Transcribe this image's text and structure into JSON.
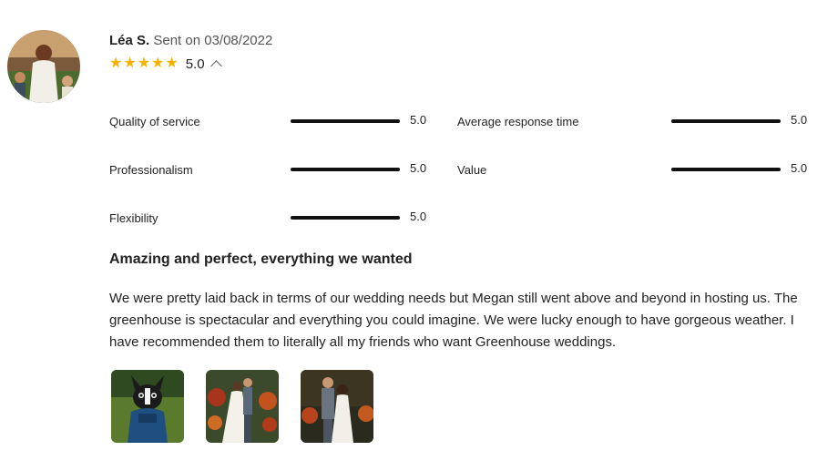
{
  "review": {
    "author": "Léa S.",
    "sent": "Sent on 03/08/2022",
    "rating": "5.0",
    "stars": 5,
    "title": "Amazing and perfect, everything we wanted",
    "body": "We were pretty laid back in terms of our wedding needs but Megan still went above and beyond in hosting us. The greenhouse is spectacular and everything you could imagine. We were lucky enough to have gorgeous weather. I have recommended them to literally all my friends who want Greenhouse weddings."
  },
  "metrics": [
    {
      "label": "Quality of service",
      "value": "5.0",
      "fill": 1.0
    },
    {
      "label": "Average response time",
      "value": "5.0",
      "fill": 1.0
    },
    {
      "label": "Professionalism",
      "value": "5.0",
      "fill": 1.0
    },
    {
      "label": "Value",
      "value": "5.0",
      "fill": 1.0
    },
    {
      "label": "Flexibility",
      "value": "5.0",
      "fill": 1.0
    }
  ],
  "colors": {
    "star": "#f5b300",
    "bar": "#111111"
  }
}
